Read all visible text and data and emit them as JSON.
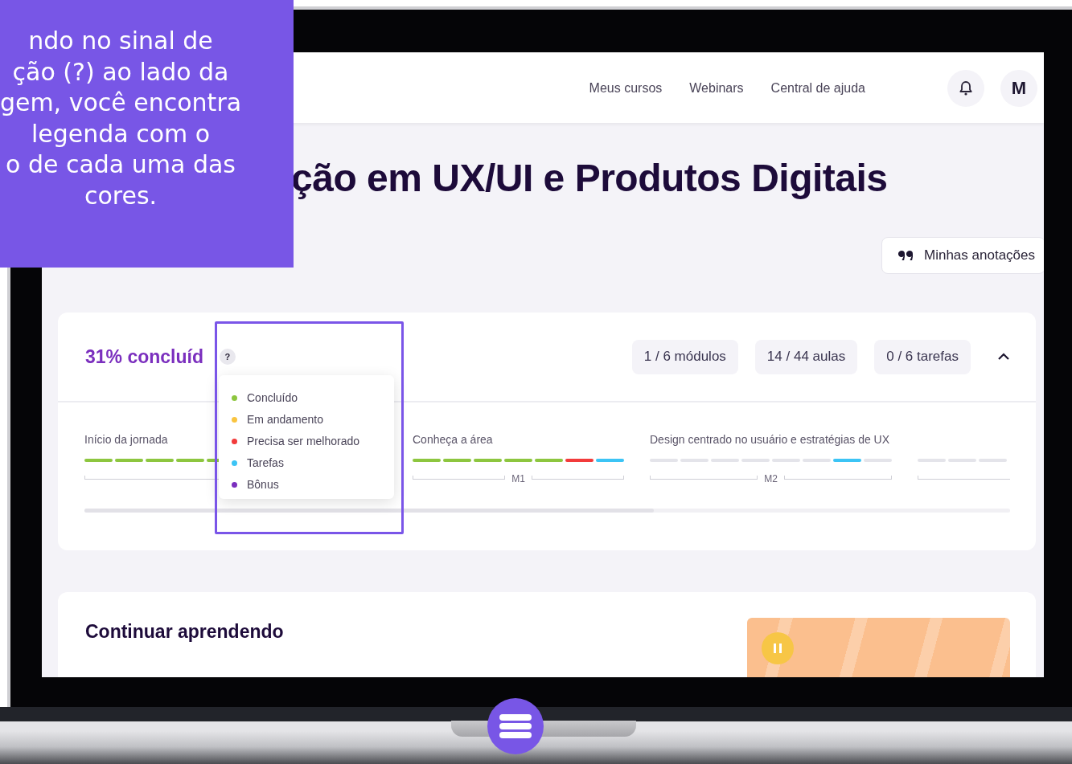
{
  "callout": {
    "text": "ndo no sinal de\nção (?) ao lado da\ngem, você encontra\nlegenda com o\no de cada uma das\ncores."
  },
  "header": {
    "nav": [
      "Meus cursos",
      "Webinars",
      "Central de ajuda"
    ],
    "avatar": "M"
  },
  "title": "ção em UX/UI e Produtos Digitais",
  "notes_button": "Minhas anotações",
  "progress": {
    "completion": "31% concluíd",
    "help": "?",
    "stats": [
      "1 / 6 módulos",
      "14 / 44 aulas",
      "0 / 6 tarefas"
    ],
    "expanded": true,
    "legend": [
      {
        "label": "Concluído",
        "color": "#8dc63f"
      },
      {
        "label": "Em andamento",
        "color": "#f9c440"
      },
      {
        "label": "Precisa ser melhorado",
        "color": "#f23b3b"
      },
      {
        "label": "Tarefas",
        "color": "#3cc4f5"
      },
      {
        "label": "Bônus",
        "color": "#7b2fbe"
      }
    ],
    "sections": [
      {
        "title": "Início da jornada",
        "segments": [
          {
            "color": "#8dc63f"
          },
          {
            "color": "#8dc63f"
          },
          {
            "color": "#8dc63f"
          },
          {
            "color": "#8dc63f"
          },
          {
            "color": "#8dc63f"
          }
        ]
      },
      {
        "title": "Conheça a área",
        "module": "M1",
        "segments": [
          {
            "color": "#8dc63f"
          },
          {
            "color": "#8dc63f"
          },
          {
            "color": "#8dc63f"
          },
          {
            "color": "#8dc63f"
          },
          {
            "color": "#8dc63f"
          },
          {
            "color": "#f23b3b"
          },
          {
            "color": "#3cc4f5"
          }
        ]
      },
      {
        "title": "Design centrado no usuário e estratégias de UX",
        "module": "M2",
        "segments": [
          {
            "color": "#e4e4ea"
          },
          {
            "color": "#e4e4ea"
          },
          {
            "color": "#e4e4ea"
          },
          {
            "color": "#e4e4ea"
          },
          {
            "color": "#e4e4ea"
          },
          {
            "color": "#e4e4ea"
          },
          {
            "color": "#3cc4f5"
          },
          {
            "color": "#e4e4ea"
          }
        ]
      },
      {
        "segments": [
          {
            "color": "#e4e4ea"
          },
          {
            "color": "#e4e4ea"
          },
          {
            "color": "#e4e4ea"
          }
        ]
      }
    ]
  },
  "continue": {
    "title": "Continuar aprendendo"
  }
}
